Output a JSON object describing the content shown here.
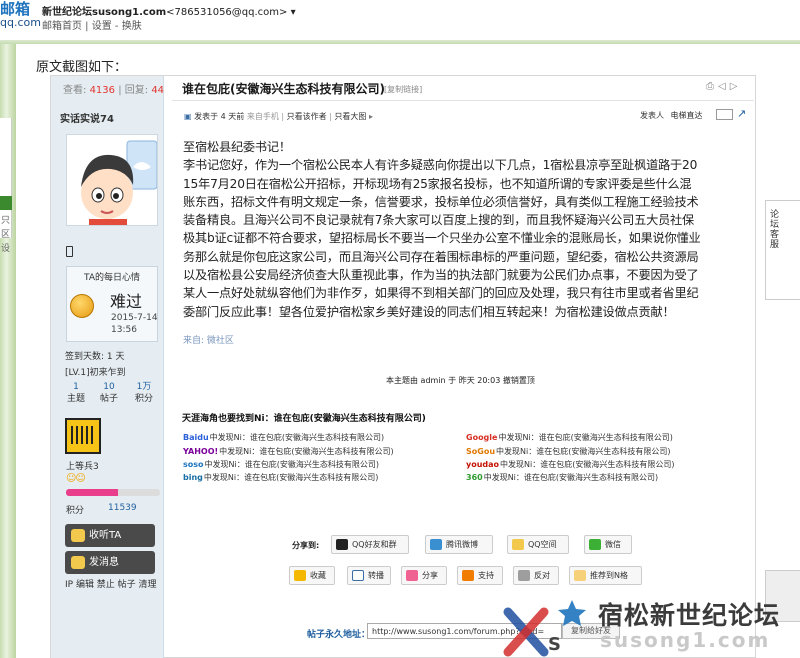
{
  "mail": {
    "logo_big": "邮箱",
    "logo_small": "qq.com",
    "from_name": "新世纪论坛susong1.com",
    "from_email": "<786531056@qq.com>",
    "links": "邮箱首页 | 设置 - 换肤"
  },
  "caption": "原文截图如下：",
  "left_nav_chars": [
    "只",
    "区",
    "设"
  ],
  "sidebar": {
    "views_label": "查看:",
    "views": "4136",
    "replies_label": "| 回复:",
    "replies": "44",
    "author": "实话实说74",
    "mood_title": "TA的每日心情",
    "mood_word": "难过",
    "mood_date": "2015-7-14",
    "mood_time": "13:56",
    "days": "签到天数: 1 天",
    "level": "[LV.1]初来乍到",
    "counts": [
      {
        "num": "1",
        "label": "主题"
      },
      {
        "num": "10",
        "label": "帖子"
      },
      {
        "num": "1万",
        "label": "积分"
      }
    ],
    "rank_name": "上等兵3",
    "rank_stars": "☺☺",
    "score_progress": 0.55,
    "score_label": "积分",
    "score_value": "11539",
    "btn_listen": "收听TA",
    "btn_message": "发消息",
    "admin_links": "IP 编辑 禁止 帖子 清理"
  },
  "post": {
    "title": "谁在包庇(安徽海兴生态科技有限公司)",
    "copy_link": "[复制链接]",
    "meta_prefix": "发表于 4 天前",
    "meta_from": "来自手机",
    "meta_author_only": "只看该作者",
    "meta_big_image": "只看大图",
    "meta_poster": "发表人",
    "meta_elevator": "电梯直达",
    "body_lines": [
      "至宿松县纪委书记！",
      "李书记您好，作为一个宿松公民本人有许多疑惑向你提出以下几点，1宿松县凉亭至趾枫道路于20",
      "15年7月20日在宿松公开招标，开标现场有25家报名投标，也不知道所谓的专家评委是些什么混",
      "账东西，招标文件有明文规定一条，信誉要求，投标单位必须信誉好，具有类似工程施工经验技术",
      "装备精良。且海兴公司不良记录就有7条大家可以百度上搜的到，而且我怀疑海兴公司五大员社保",
      "极其b证c证都不符合要求，望招标局长不要当一个只坐办公室不懂业余的混账局长，如果说你懂业",
      "务那么就是你包庇这家公司，而且海兴公司存在着围标串标的严重问题，望纪委，宿松公共资源局",
      "以及宿松县公安局经济侦查大队重视此事，作为当的执法部门就要为公民们办点事，不要因为受了",
      "某人一点好处就纵容他们为非作歹，如果得不到相关部门的回应及处理，我只有往市里或者省里纪",
      "委部门反应此事！望各位爱护宿松家乡美好建设的同志们相互转起来！为宿松建设做点贡献！"
    ],
    "source": "来自: 微社区",
    "mod_info": "本主题由 admin 于 昨天 20:03 撤销置顶",
    "ad_title": "天涯海角也要找到Ni：谁在包庇(安徽海兴生态科技有限公司)",
    "ad_rows": [
      {
        "engine": "Baidu",
        "text": "中发现Ni：谁在包庇(安徽海兴生态科技有限公司)",
        "color": "#2a60d9"
      },
      {
        "engine": "YAHOO!",
        "text": "中发现Ni：谁在包庇(安徽海兴生态科技有限公司)",
        "color": "#7b0099"
      },
      {
        "engine": "soso",
        "text": "中发现Ni：谁在包庇(安徽海兴生态科技有限公司)",
        "color": "#1e73be"
      },
      {
        "engine": "bing",
        "text": "中发现Ni：谁在包庇(安徽海兴生态科技有限公司)",
        "color": "#1a6fa3"
      },
      {
        "engine": "Google",
        "text": "中发现Ni：谁在包庇(安徽海兴生态科技有限公司)",
        "color": "#d93025"
      },
      {
        "engine": "SoGou",
        "text": "中发现Ni：谁在包庇(安徽海兴生态科技有限公司)",
        "color": "#e07800"
      },
      {
        "engine": "youdao",
        "text": "中发现Ni：谁在包庇(安徽海兴生态科技有限公司)",
        "color": "#c41200"
      },
      {
        "engine": "360",
        "text": "中发现Ni：谁在包庇(安徽海兴生态科技有限公司)",
        "color": "#2f9b2f"
      }
    ],
    "share_label": "分享到:",
    "share_buttons": [
      "QQ好友和群",
      "腾讯微博",
      "QQ空间",
      "微信"
    ],
    "action_buttons": [
      "收藏",
      "转播",
      "分享",
      "支持",
      "反对",
      "推荐到N格"
    ],
    "permalink_label": "帖子永久地址：",
    "permalink_value": "http://www.susong1.com/forum.php?mod=",
    "permalink_copy": "复制给好友"
  },
  "watermark": {
    "cn": "宿松新世纪论坛",
    "url": "susong1.com"
  },
  "right_tab_text": "论坛客服"
}
